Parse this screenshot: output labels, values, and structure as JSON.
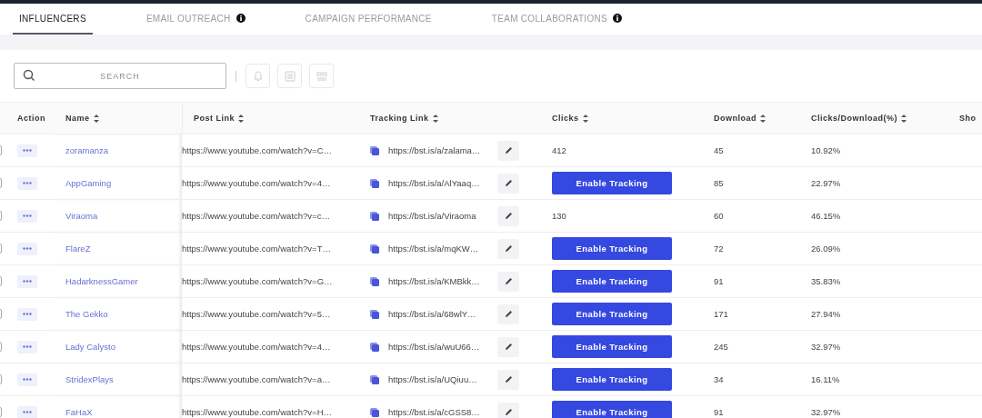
{
  "tabs": [
    {
      "label": "INFLUENCERS",
      "selected": true,
      "disabled": false,
      "info": false
    },
    {
      "label": "EMAIL OUTREACH",
      "selected": false,
      "disabled": true,
      "info": true
    },
    {
      "label": "CAMPAIGN PERFORMANCE",
      "selected": false,
      "disabled": true,
      "info": false
    },
    {
      "label": "TEAM COLLABORATIONS",
      "selected": false,
      "disabled": true,
      "info": true
    }
  ],
  "search": {
    "placeholder": "SEARCH"
  },
  "table": {
    "columns": [
      {
        "label": "Action",
        "sortable": false
      },
      {
        "label": "Name",
        "sortable": true
      },
      {
        "label": "Post Link",
        "sortable": true
      },
      {
        "label": "Tracking Link",
        "sortable": true
      },
      {
        "label": "Clicks",
        "sortable": true
      },
      {
        "label": "Download",
        "sortable": true
      },
      {
        "label": "Clicks/Download(%)",
        "sortable": true
      },
      {
        "label": "Sho",
        "sortable": false
      }
    ],
    "rows": [
      {
        "checked": false,
        "name": "zoramanza",
        "post_link": "https://www.youtube.com/watch?v=C…",
        "tracking_link": "https://bst.is/a/zalama…",
        "clicks": {
          "kind": "value",
          "text": "412"
        },
        "download": "45",
        "ratio": "10.92%"
      },
      {
        "checked": false,
        "name": "AppGaming",
        "post_link": "https://www.youtube.com/watch?v=4…",
        "tracking_link": "https://bst.is/a/AlYaaq…",
        "clicks": {
          "kind": "button",
          "text": "Enable Tracking"
        },
        "download": "85",
        "ratio": "22.97%"
      },
      {
        "checked": false,
        "name": "Viraoma",
        "post_link": "https://www.youtube.com/watch?v=c…",
        "tracking_link": "https://bst.is/a/Viraoma",
        "clicks": {
          "kind": "value",
          "text": "130"
        },
        "download": "60",
        "ratio": "46.15%"
      },
      {
        "checked": false,
        "name": "FlareZ",
        "post_link": "https://www.youtube.com/watch?v=T…",
        "tracking_link": "https://bst.is/a/mqKW…",
        "clicks": {
          "kind": "button",
          "text": "Enable Tracking"
        },
        "download": "72",
        "ratio": "26.09%"
      },
      {
        "checked": false,
        "name": "HadarknessGamer",
        "post_link": "https://www.youtube.com/watch?v=G…",
        "tracking_link": "https://bst.is/a/KMBkk…",
        "clicks": {
          "kind": "button",
          "text": "Enable Tracking"
        },
        "download": "91",
        "ratio": "35.83%"
      },
      {
        "checked": false,
        "name": "The Gekko",
        "post_link": "https://www.youtube.com/watch?v=5…",
        "tracking_link": "https://bst.is/a/68wlY…",
        "clicks": {
          "kind": "button",
          "text": "Enable Tracking"
        },
        "download": "171",
        "ratio": "27.94%"
      },
      {
        "checked": false,
        "name": "Lady Calysto",
        "post_link": "https://www.youtube.com/watch?v=4…",
        "tracking_link": "https://bst.is/a/wuU66…",
        "clicks": {
          "kind": "button",
          "text": "Enable Tracking"
        },
        "download": "245",
        "ratio": "32.97%"
      },
      {
        "checked": false,
        "name": "StridexPlays",
        "post_link": "https://www.youtube.com/watch?v=a…",
        "tracking_link": "https://bst.is/a/UQiuu…",
        "clicks": {
          "kind": "button",
          "text": "Enable Tracking"
        },
        "download": "34",
        "ratio": "16.11%"
      },
      {
        "checked": false,
        "name": "FaHaX",
        "post_link": "https://www.youtube.com/watch?v=H…",
        "tracking_link": "https://bst.is/a/cGSS8…",
        "clicks": {
          "kind": "button",
          "text": "Enable Tracking"
        },
        "download": "91",
        "ratio": "32.97%"
      }
    ]
  }
}
